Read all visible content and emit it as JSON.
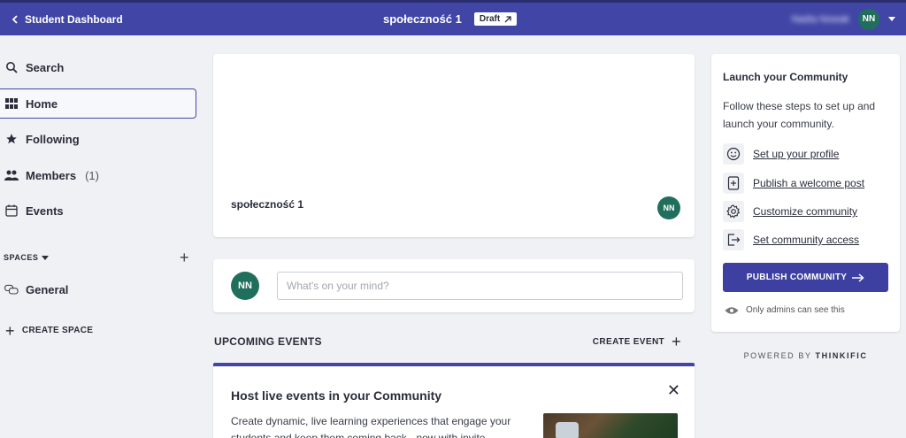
{
  "topbar": {
    "back_label": "Student Dashboard",
    "community_title": "społeczność 1",
    "draft_label": "Draft",
    "user_name": "Nadia Nowak",
    "user_initials": "NN"
  },
  "sidebar": {
    "items": [
      {
        "label": "Search",
        "icon": "search-icon"
      },
      {
        "label": "Home",
        "icon": "grid-icon",
        "active": true
      },
      {
        "label": "Following",
        "icon": "star-icon"
      },
      {
        "label": "Members",
        "count": "(1)",
        "icon": "members-icon"
      },
      {
        "label": "Events",
        "icon": "calendar-icon"
      }
    ],
    "spaces_header": "SPACES",
    "spaces": [
      {
        "label": "General",
        "icon": "chat-bubbles-icon"
      }
    ],
    "create_space_label": "CREATE SPACE"
  },
  "hero": {
    "title": "społeczność 1",
    "avatar_initials": "NN"
  },
  "composer": {
    "avatar_initials": "NN",
    "placeholder": "What's on your mind?"
  },
  "events": {
    "title": "UPCOMING EVENTS",
    "create_label": "CREATE EVENT"
  },
  "promo": {
    "title": "Host live events in your Community",
    "body": "Create dynamic, live learning experiences that engage your students and keep them coming back - now with invite"
  },
  "launch": {
    "title": "Launch your Community",
    "description": "Follow these steps to set up and launch your community.",
    "steps": [
      {
        "label": "Set up your profile",
        "icon": "smiley-icon"
      },
      {
        "label": "Publish a welcome post",
        "icon": "document-plus-icon"
      },
      {
        "label": "Customize community",
        "icon": "gear-icon"
      },
      {
        "label": "Set community access",
        "icon": "door-exit-icon"
      }
    ],
    "publish_label": "PUBLISH COMMUNITY",
    "admin_note": "Only admins can see this"
  },
  "powered": {
    "prefix": "POWERED BY",
    "brand": "THINKIFIC"
  },
  "colors": {
    "primary": "#4146a6",
    "avatar": "#1f6f5c",
    "background": "#f0f1f4"
  }
}
